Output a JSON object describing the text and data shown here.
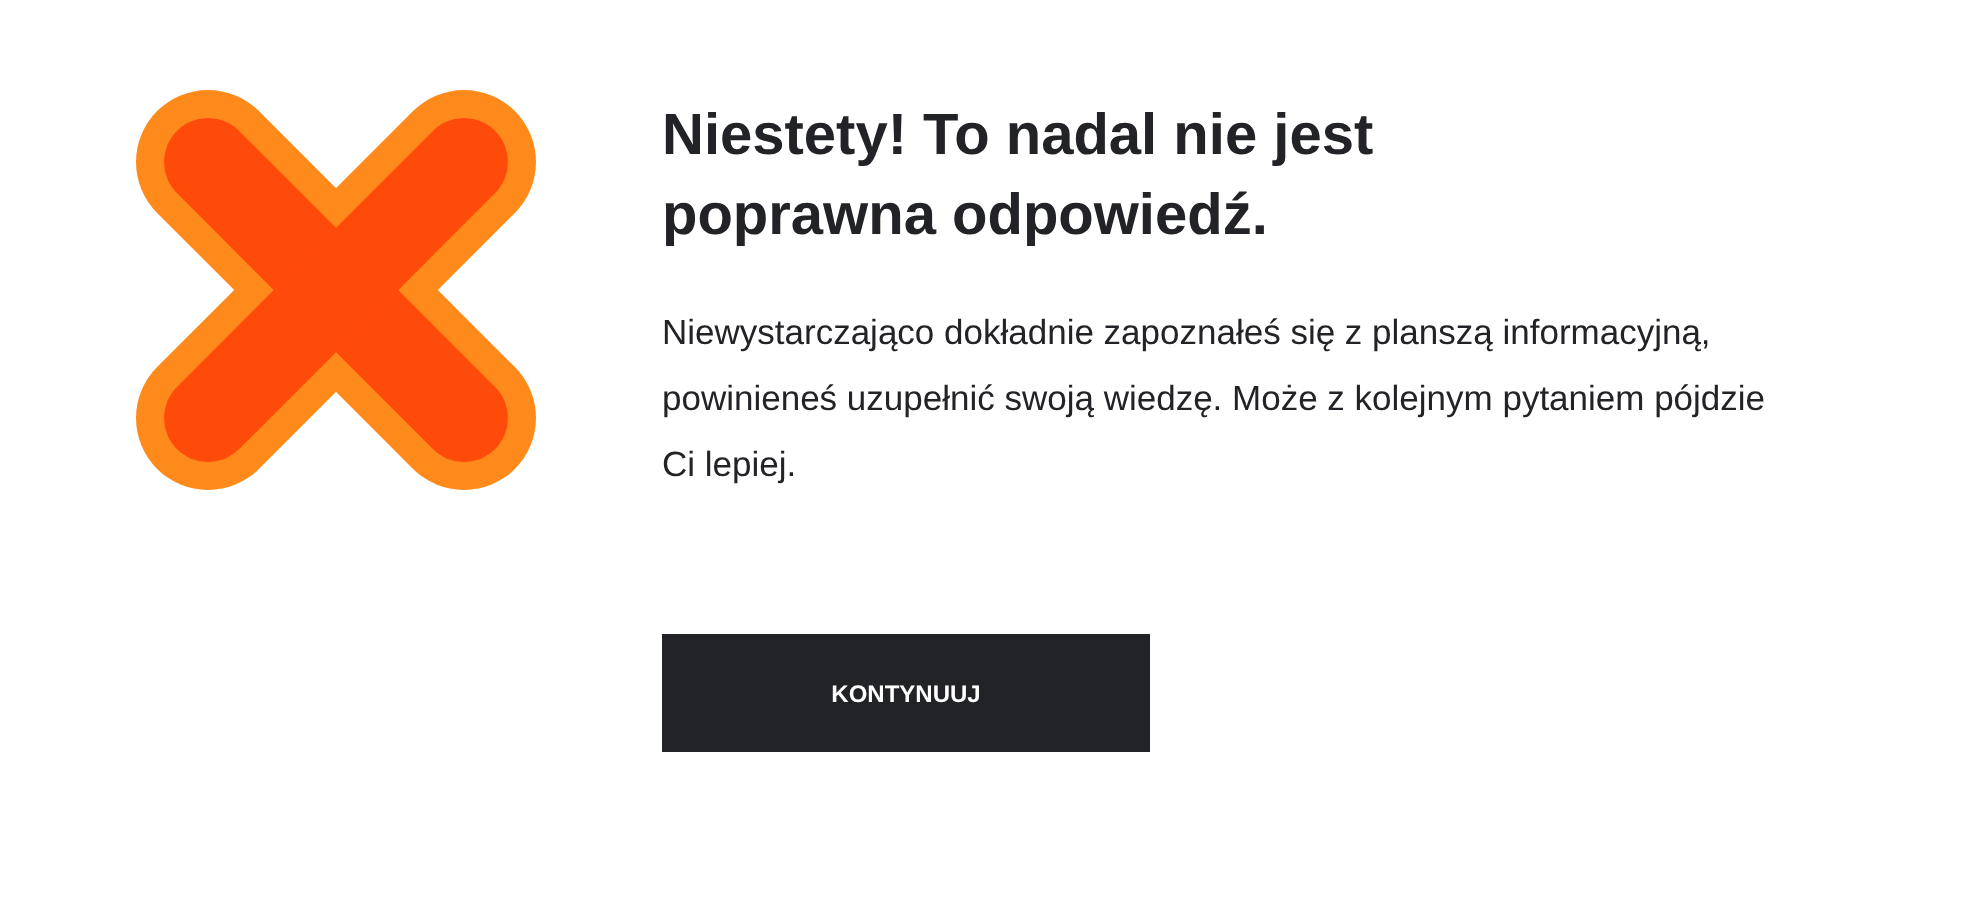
{
  "result": {
    "correct": false
  },
  "heading": "Niestety! To nadal nie jest poprawna odpowiedź.",
  "message": "Niewystarczająco dokładnie zapoznałeś się z planszą informacyjną, powinieneś uzupełnić swoją wiedzę. Może z kolejnym pytaniem pójdzie Ci lepiej.",
  "button": "KONTYNUUJ"
}
